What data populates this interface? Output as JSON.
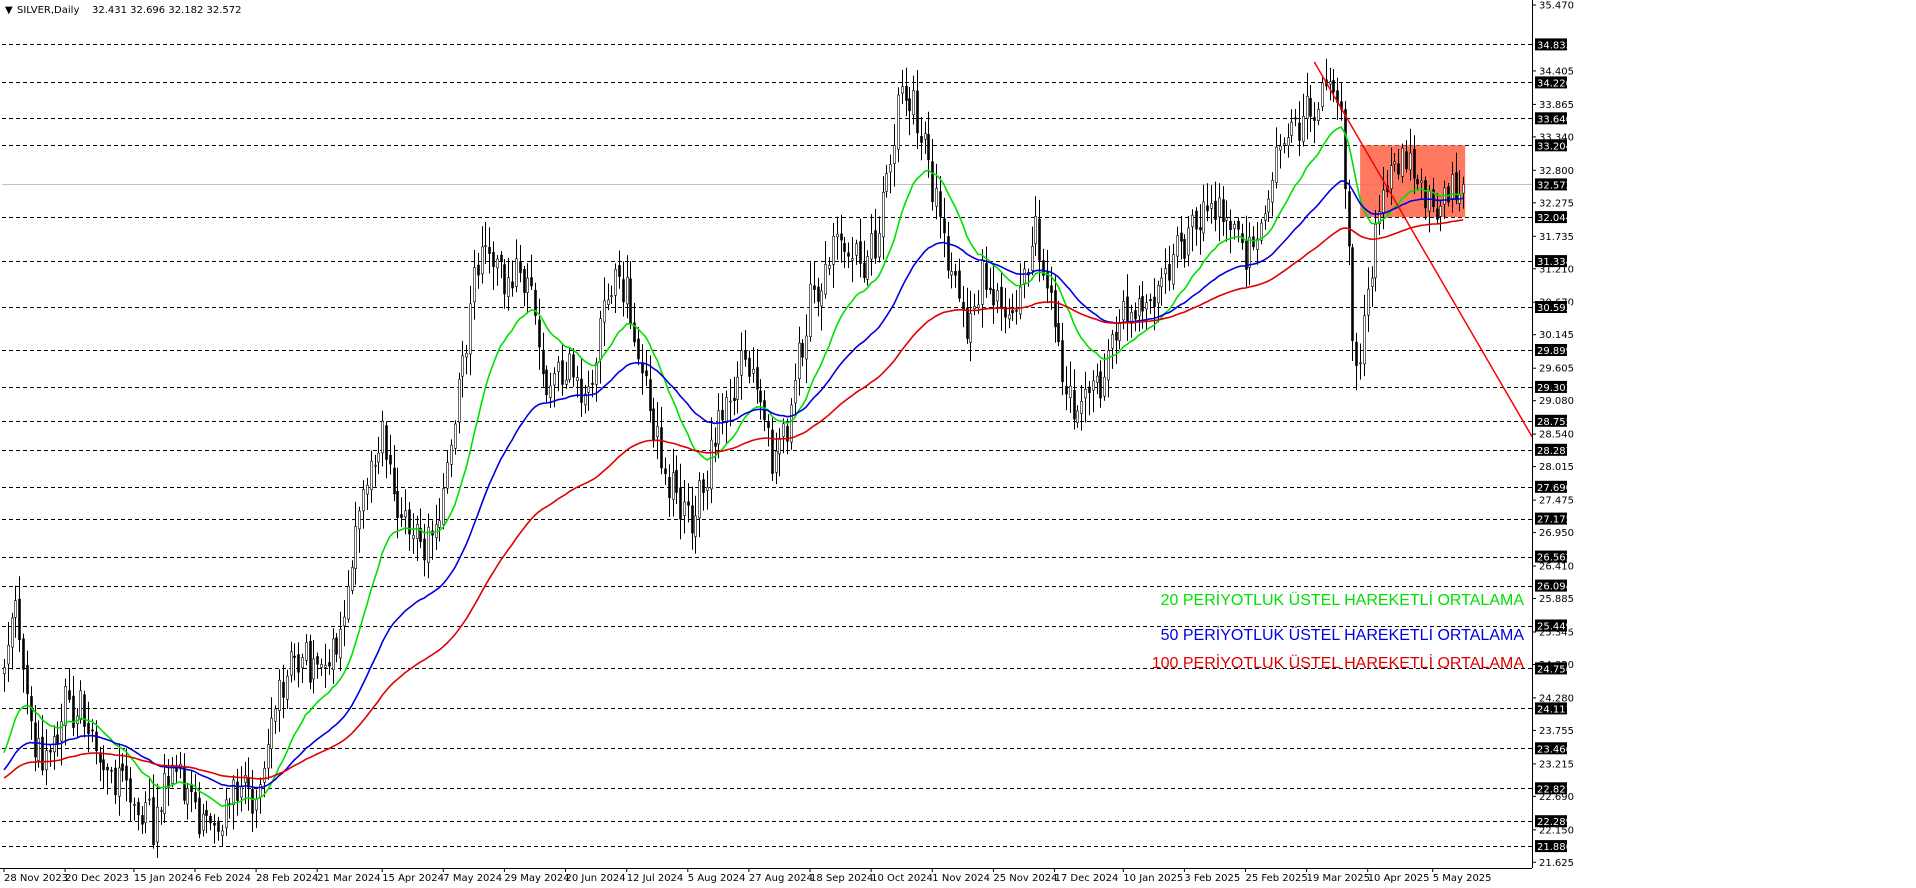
{
  "header": {
    "symbol": "SILVER,Daily",
    "ohlc": "32.431 32.696 32.182 32.572"
  },
  "colors": {
    "background": "#ffffff",
    "candles": "#000000",
    "grid": "#000000",
    "ema20": "#00e000",
    "ema50": "#0000e0",
    "ema100": "#e00000",
    "trendline": "#ff0000",
    "zone": "#ff6a50"
  },
  "legend": {
    "ema20": "20 PERİYOTLUK ÜSTEL HAREKETLİ ORTALAMA",
    "ema50": "50 PERİYOTLUK ÜSTEL HAREKETLİ ORTALAMA",
    "ema100": "100 PERİYOTLUK ÜSTEL HAREKETLİ ORTALAMA"
  },
  "chart_data": {
    "type": "candlestick",
    "symbol": "SILVER",
    "timeframe": "Daily",
    "last_ohlc": {
      "open": 32.431,
      "high": 32.696,
      "low": 32.182,
      "close": 32.572
    },
    "current_price": 32.572,
    "ylim": [
      21.63,
      35.47
    ],
    "x_tick_labels": [
      "28 Nov 2023",
      "20 Dec 2023",
      "15 Jan 2024",
      "6 Feb 2024",
      "28 Feb 2024",
      "21 Mar 2024",
      "15 Apr 2024",
      "7 May 2024",
      "29 May 2024",
      "20 Jun 2024",
      "12 Jul 2024",
      "5 Aug 2024",
      "27 Aug 2024",
      "18 Sep 2024",
      "10 Oct 2024",
      "1 Nov 2024",
      "25 Nov 2024",
      "17 Dec 2024",
      "10 Jan 2025",
      "3 Feb 2025",
      "25 Feb 2025",
      "19 Mar 2025",
      "10 Apr 2025",
      "5 May 2025"
    ],
    "y_tick_labels": [
      "35.470",
      "34.405",
      "33.865",
      "33.340",
      "32.800",
      "32.275",
      "31.735",
      "31.210",
      "30.670",
      "30.145",
      "29.605",
      "29.080",
      "28.540",
      "28.015",
      "27.475",
      "26.950",
      "26.410",
      "25.885",
      "25.345",
      "24.820",
      "24.280",
      "23.755",
      "23.215",
      "22.690",
      "22.150",
      "21.625"
    ],
    "horizontal_levels": [
      34.833,
      34.22,
      33.64,
      33.204,
      32.044,
      31.334,
      30.593,
      29.899,
      29.303,
      28.755,
      28.287,
      27.69,
      27.175,
      26.562,
      26.094,
      25.449,
      24.756,
      24.111,
      23.466,
      22.821,
      22.289,
      21.886
    ],
    "close_anchors": [
      {
        "date": "28 Nov 2023",
        "value": 24.6
      },
      {
        "date": "1 Dec 2023",
        "value": 25.9
      },
      {
        "date": "8 Dec 2023",
        "value": 23.4
      },
      {
        "date": "14 Dec 2023",
        "value": 23.3
      },
      {
        "date": "20 Dec 2023",
        "value": 24.2
      },
      {
        "date": "28 Dec 2023",
        "value": 24.0
      },
      {
        "date": "5 Jan 2024",
        "value": 23.0
      },
      {
        "date": "15 Jan 2024",
        "value": 22.7
      },
      {
        "date": "22 Jan 2024",
        "value": 22.2
      },
      {
        "date": "29 Jan 2024",
        "value": 23.2
      },
      {
        "date": "6 Feb 2024",
        "value": 22.5
      },
      {
        "date": "14 Feb 2024",
        "value": 22.2
      },
      {
        "date": "21 Feb 2024",
        "value": 22.9
      },
      {
        "date": "28 Feb 2024",
        "value": 22.6
      },
      {
        "date": "6 Mar 2024",
        "value": 24.1
      },
      {
        "date": "13 Mar 2024",
        "value": 25.0
      },
      {
        "date": "21 Mar 2024",
        "value": 24.7
      },
      {
        "date": "28 Mar 2024",
        "value": 25.0
      },
      {
        "date": "5 Apr 2024",
        "value": 27.3
      },
      {
        "date": "15 Apr 2024",
        "value": 28.6
      },
      {
        "date": "22 Apr 2024",
        "value": 27.1
      },
      {
        "date": "30 Apr 2024",
        "value": 26.6
      },
      {
        "date": "7 May 2024",
        "value": 27.6
      },
      {
        "date": "13 May 2024",
        "value": 29.3
      },
      {
        "date": "21 May 2024",
        "value": 31.8
      },
      {
        "date": "29 May 2024",
        "value": 31.0
      },
      {
        "date": "6 Jun 2024",
        "value": 31.0
      },
      {
        "date": "13 Jun 2024",
        "value": 29.3
      },
      {
        "date": "20 Jun 2024",
        "value": 29.6
      },
      {
        "date": "28 Jun 2024",
        "value": 29.2
      },
      {
        "date": "5 Jul 2024",
        "value": 31.0
      },
      {
        "date": "12 Jul 2024",
        "value": 30.8
      },
      {
        "date": "19 Jul 2024",
        "value": 29.3
      },
      {
        "date": "26 Jul 2024",
        "value": 27.8
      },
      {
        "date": "5 Aug 2024",
        "value": 27.2
      },
      {
        "date": "9 Aug 2024",
        "value": 27.6
      },
      {
        "date": "16 Aug 2024",
        "value": 29.0
      },
      {
        "date": "21 Aug 2024",
        "value": 29.3
      },
      {
        "date": "27 Aug 2024",
        "value": 29.8
      },
      {
        "date": "4 Sep 2024",
        "value": 28.0
      },
      {
        "date": "10 Sep 2024",
        "value": 28.6
      },
      {
        "date": "18 Sep 2024",
        "value": 30.7
      },
      {
        "date": "26 Sep 2024",
        "value": 31.6
      },
      {
        "date": "3 Oct 2024",
        "value": 31.3
      },
      {
        "date": "10 Oct 2024",
        "value": 31.5
      },
      {
        "date": "16 Oct 2024",
        "value": 32.5
      },
      {
        "date": "22 Oct 2024",
        "value": 34.2
      },
      {
        "date": "25 Oct 2024",
        "value": 33.8
      },
      {
        "date": "1 Nov 2024",
        "value": 32.6
      },
      {
        "date": "7 Nov 2024",
        "value": 31.3
      },
      {
        "date": "14 Nov 2024",
        "value": 30.2
      },
      {
        "date": "20 Nov 2024",
        "value": 31.1
      },
      {
        "date": "25 Nov 2024",
        "value": 30.6
      },
      {
        "date": "3 Dec 2024",
        "value": 30.4
      },
      {
        "date": "10 Dec 2024",
        "value": 31.8
      },
      {
        "date": "17 Dec 2024",
        "value": 30.3
      },
      {
        "date": "20 Dec 2024",
        "value": 29.1
      },
      {
        "date": "31 Dec 2024",
        "value": 29.1
      },
      {
        "date": "10 Jan 2025",
        "value": 30.3
      },
      {
        "date": "20 Jan 2025",
        "value": 30.6
      },
      {
        "date": "3 Feb 2025",
        "value": 31.7
      },
      {
        "date": "10 Feb 2025",
        "value": 32.1
      },
      {
        "date": "14 Feb 2025",
        "value": 32.2
      },
      {
        "date": "25 Feb 2025",
        "value": 31.4
      },
      {
        "date": "5 Mar 2025",
        "value": 32.4
      },
      {
        "date": "12 Mar 2025",
        "value": 33.6
      },
      {
        "date": "19 Mar 2025",
        "value": 33.7
      },
      {
        "date": "27 Mar 2025",
        "value": 34.3
      },
      {
        "date": "1 Apr 2025",
        "value": 34.0
      },
      {
        "date": "4 Apr 2025",
        "value": 30.2
      },
      {
        "date": "8 Apr 2025",
        "value": 29.4
      },
      {
        "date": "10 Apr 2025",
        "value": 30.9
      },
      {
        "date": "15 Apr 2025",
        "value": 32.3
      },
      {
        "date": "22 Apr 2025",
        "value": 33.0
      },
      {
        "date": "28 Apr 2025",
        "value": 32.9
      },
      {
        "date": "5 May 2025",
        "value": 32.2
      },
      {
        "date": "9 May 2025",
        "value": 32.4
      },
      {
        "date": "13 May 2025",
        "value": 32.6
      }
    ],
    "series": [
      {
        "name": "20 PERİYOTLUK ÜSTEL HAREKETLİ ORTALAMA",
        "period": 20,
        "color": "#00e000"
      },
      {
        "name": "50 PERİYOTLUK ÜSTEL HAREKETLİ ORTALAMA",
        "period": 50,
        "color": "#0000e0"
      },
      {
        "name": "100 PERİYOTLUK ÜSTEL HAREKETLİ ORTALAMA",
        "period": 100,
        "color": "#e00000"
      }
    ],
    "trendline": {
      "start": {
        "date": "21 Mar 2025",
        "value": 34.55
      },
      "end": {
        "date": "end of chart",
        "value": 28.5
      },
      "color": "#ff0000"
    },
    "zone": {
      "start": "8 Apr 2025",
      "end": "15 May 2025",
      "top": 33.204,
      "bottom": 32.044,
      "color": "#ff6a50"
    },
    "grid": "horizontal dashed",
    "legend_placement": "bottom-right"
  }
}
